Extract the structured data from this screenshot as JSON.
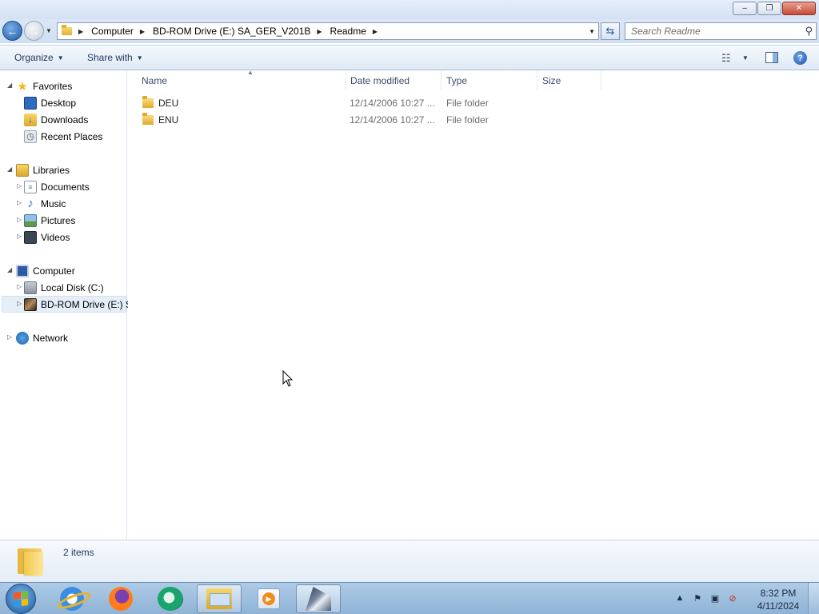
{
  "window": {
    "minimize_glyph": "‒",
    "maximize_glyph": "❐",
    "close_glyph": "✕"
  },
  "address": {
    "breadcrumbs": [
      {
        "label": "Computer"
      },
      {
        "label": "BD-ROM Drive (E:) SA_GER_V201B"
      },
      {
        "label": "Readme"
      }
    ]
  },
  "search": {
    "placeholder": "Search Readme"
  },
  "toolbar": {
    "organize_label": "Organize",
    "share_label": "Share with"
  },
  "navpane": {
    "favorites": {
      "label": "Favorites",
      "items": [
        {
          "label": "Desktop",
          "icon": "desktop-icon"
        },
        {
          "label": "Downloads",
          "icon": "downloads-icon"
        },
        {
          "label": "Recent Places",
          "icon": "recent-places-icon"
        }
      ]
    },
    "libraries": {
      "label": "Libraries",
      "items": [
        {
          "label": "Documents",
          "icon": "documents-icon"
        },
        {
          "label": "Music",
          "icon": "music-icon"
        },
        {
          "label": "Pictures",
          "icon": "pictures-icon"
        },
        {
          "label": "Videos",
          "icon": "videos-icon"
        }
      ]
    },
    "computer": {
      "label": "Computer",
      "items": [
        {
          "label": "Local Disk (C:)",
          "icon": "local-disk-icon"
        },
        {
          "label": "BD-ROM Drive (E:) S",
          "icon": "bd-rom-icon",
          "selected": true
        }
      ]
    },
    "network": {
      "label": "Network"
    }
  },
  "columns": {
    "name": "Name",
    "date": "Date modified",
    "type": "Type",
    "size": "Size"
  },
  "files": [
    {
      "name": "DEU",
      "date": "12/14/2006 10:27 ...",
      "type": "File folder",
      "size": ""
    },
    {
      "name": "ENU",
      "date": "12/14/2006 10:27 ...",
      "type": "File folder",
      "size": ""
    }
  ],
  "details": {
    "item_count": "2 items"
  },
  "taskbar": {
    "pinned": [
      {
        "name": "internet-explorer-icon"
      },
      {
        "name": "firefox-icon"
      },
      {
        "name": "green-app-icon"
      },
      {
        "name": "windows-explorer-icon",
        "active": true
      },
      {
        "name": "media-player-icon"
      },
      {
        "name": "running-app-icon",
        "active": true
      }
    ],
    "clock": {
      "time": "8:32 PM",
      "date": "4/11/2024"
    }
  },
  "colors": {
    "selection": "#e5eef9",
    "header_text": "#3b4c6b",
    "taskbar": "#8fb3d6"
  }
}
